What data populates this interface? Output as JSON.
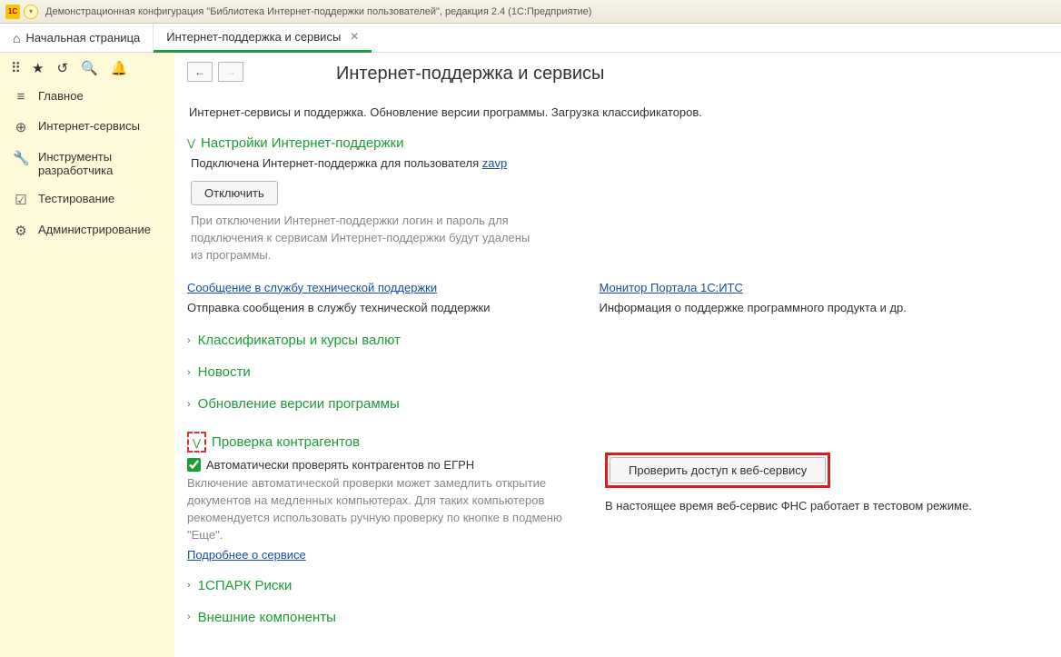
{
  "window": {
    "title": "Демонстрационная конфигурация \"Библиотека Интернет-поддержки пользователей\", редакция 2.4  (1С:Предприятие)"
  },
  "tabs": {
    "home": "Начальная страница",
    "active": "Интернет-поддержка и сервисы"
  },
  "sidebar": {
    "items": [
      {
        "icon": "≡",
        "label": "Главное"
      },
      {
        "icon": "⊕",
        "label": "Интернет-сервисы"
      },
      {
        "icon": "🔧",
        "label": "Инструменты разработчика"
      },
      {
        "icon": "☑",
        "label": "Тестирование"
      },
      {
        "icon": "⚙",
        "label": "Администрирование"
      }
    ]
  },
  "page": {
    "title": "Интернет-поддержка и сервисы",
    "subtitle": "Интернет-сервисы и поддержка. Обновление версии программы. Загрузка классификаторов.",
    "s1": {
      "head": "Настройки Интернет-поддержки",
      "connected_prefix": "Подключена Интернет-поддержка для пользователя ",
      "user": "zavp",
      "disconnect": "Отключить",
      "note": "При отключении Интернет-поддержки логин и пароль для подключения к сервисам Интернет-поддержки будут удалены из программы."
    },
    "links": {
      "support_msg": "Сообщение в службу технической поддержки",
      "support_msg_desc": "Отправка сообщения в службу технической поддержки",
      "portal": "Монитор Портала 1С:ИТС",
      "portal_desc": "Информация о поддержке программного продукта и др."
    },
    "exp": {
      "classifiers": "Классификаторы и курсы валют",
      "news": "Новости",
      "update": "Обновление версии программы"
    },
    "contr": {
      "head": "Проверка контрагентов",
      "cb": "Автоматически проверять контрагентов по ЕГРН",
      "desc": "Включение автоматической проверки может замедлить открытие документов на медленных компьютерах. Для таких компьютеров рекомендуется использовать ручную проверку по кнопке в подменю \"Еще\".",
      "more": "Подробнее о сервисе",
      "btn": "Проверить доступ к веб-сервису",
      "svc": "В настоящее время веб-сервис ФНС работает в тестовом режиме."
    },
    "exp2": {
      "spark": "1СПАРК Риски",
      "ext": "Внешние компоненты"
    }
  }
}
